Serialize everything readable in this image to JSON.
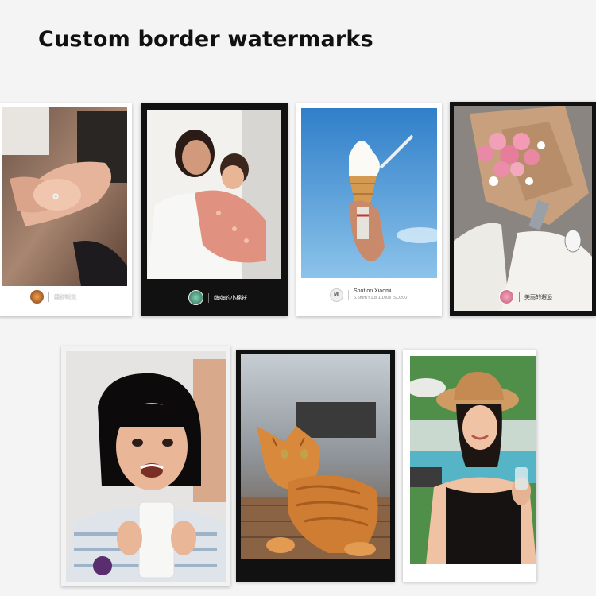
{
  "page": {
    "title": "Custom border watermarks"
  },
  "cards": [
    {
      "id": "hands",
      "border": "white",
      "watermark": {
        "text": "美好时光",
        "color": "#ffffff"
      }
    },
    {
      "id": "mother-child",
      "border": "black",
      "watermark": {
        "text": "嗨嗨的小棉袄",
        "color": "#ffffff"
      }
    },
    {
      "id": "ice-cream",
      "border": "white",
      "watermark": {
        "line1": "Shot on Xiaomi",
        "line2": "6.5mm f/1.8 1/100s ISO200",
        "logo": "MI"
      }
    },
    {
      "id": "bouquet",
      "border": "black",
      "watermark": {
        "text": "美丽的邂逅",
        "color": "#333333"
      }
    },
    {
      "id": "girl-milk",
      "border": "white"
    },
    {
      "id": "cat",
      "border": "black"
    },
    {
      "id": "woman-hat",
      "border": "white"
    }
  ],
  "colors": {
    "background": "#f4f4f4",
    "black_border": "#111111",
    "white_border": "#ffffff"
  }
}
